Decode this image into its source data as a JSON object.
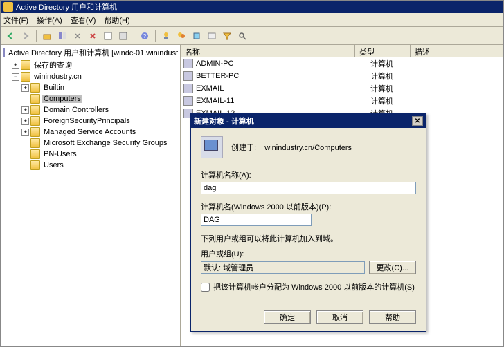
{
  "window": {
    "title": "Active Directory 用户和计算机"
  },
  "menu": {
    "file": "文件(F)",
    "action": "操作(A)",
    "view": "查看(V)",
    "help": "帮助(H)"
  },
  "tree": {
    "root": "Active Directory 用户和计算机 [windc-01.winindust",
    "saved_queries": "保存的查询",
    "domain": "winindustry.cn",
    "builtin": "Builtin",
    "computers": "Computers",
    "domain_controllers": "Domain Controllers",
    "fsp": "ForeignSecurityPrincipals",
    "msa": "Managed Service Accounts",
    "mesg": "Microsoft Exchange Security Groups",
    "pnusers": "PN-Users",
    "users": "Users"
  },
  "list": {
    "col_name": "名称",
    "col_type": "类型",
    "col_desc": "描述",
    "rows": [
      {
        "name": "ADMIN-PC",
        "type": "计算机"
      },
      {
        "name": "BETTER-PC",
        "type": "计算机"
      },
      {
        "name": "EXMAIL",
        "type": "计算机"
      },
      {
        "name": "EXMAIL-11",
        "type": "计算机"
      },
      {
        "name": "EXMAIL-12",
        "type": "计算机"
      }
    ]
  },
  "dialog": {
    "title": "新建对象 - 计算机",
    "created_in_label": "创建于:",
    "created_in_value": "winindustry.cn/Computers",
    "name_label": "计算机名称(A):",
    "name_value": "dag",
    "prewin_label": "计算机名(Windows 2000 以前版本)(P):",
    "prewin_value": "DAG",
    "join_desc": "下列用户或组可以将此计算机加入到域。",
    "usergroup_label": "用户或组(U):",
    "usergroup_value": "默认: 域管理员",
    "change_btn": "更改(C)...",
    "checkbox_label": "把该计算机帐户分配为 Windows 2000 以前版本的计算机(S)",
    "ok": "确定",
    "cancel": "取消",
    "help": "帮助"
  }
}
